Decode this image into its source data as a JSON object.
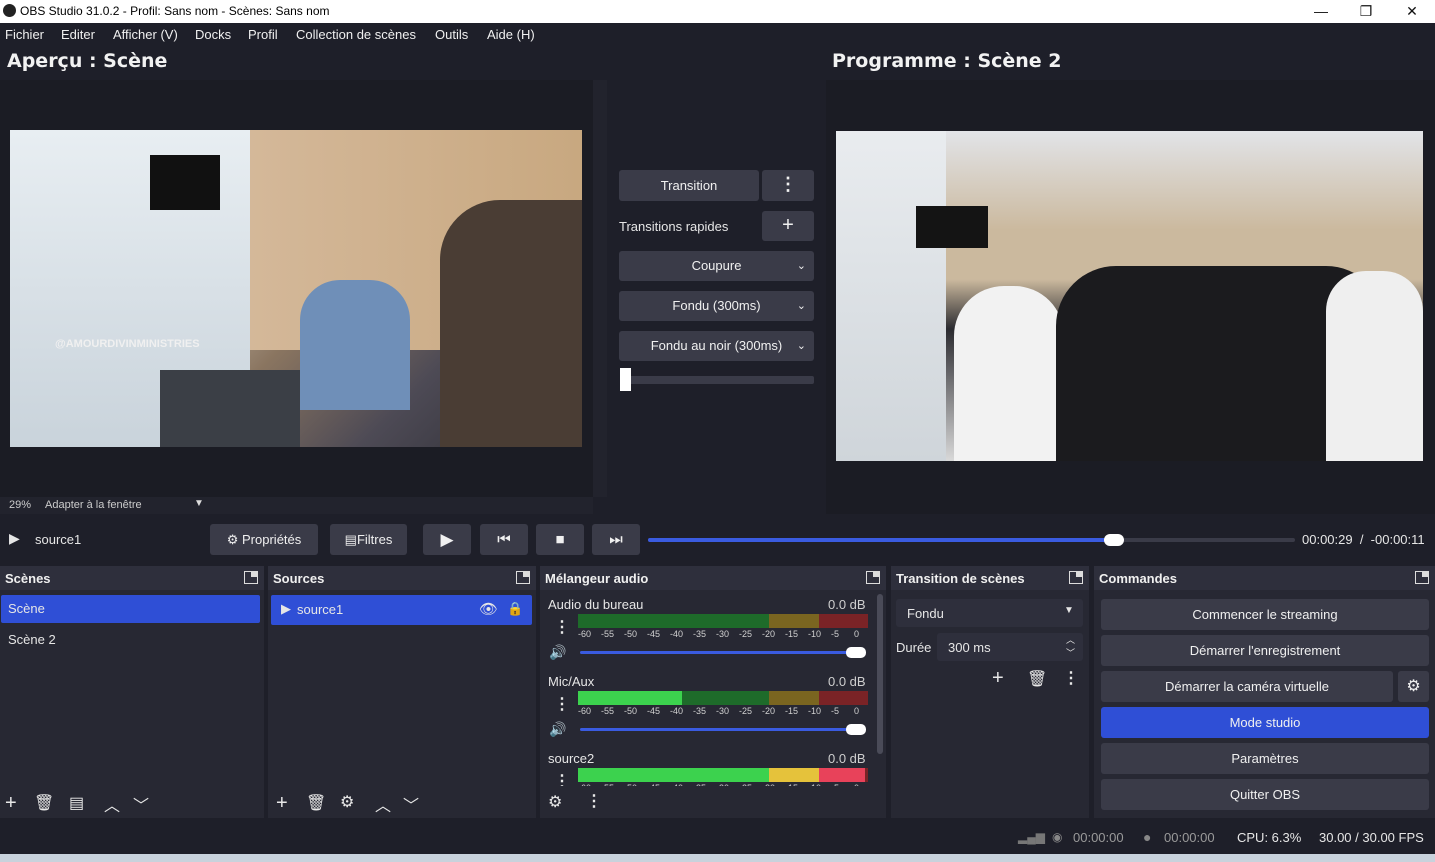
{
  "window": {
    "title": "OBS Studio 31.0.2 - Profil: Sans nom - Scènes: Sans nom",
    "minimize": "—",
    "maximize": "❐",
    "close": "✕"
  },
  "menu": [
    "Fichier",
    "Editer",
    "Afficher (V)",
    "Docks",
    "Profil",
    "Collection de scènes",
    "Outils",
    "Aide (H)"
  ],
  "preview": {
    "title": "Aperçu : Scène",
    "zoom": "29%",
    "fit": "Adapter à la fenêtre",
    "watermark": "@AMOURDIVINMINISTRIES"
  },
  "program": {
    "title": "Programme : Scène 2"
  },
  "transitions": {
    "transition_label": "Transition",
    "quick_label": "Transitions rapides",
    "items": [
      "Coupure",
      "Fondu (300ms)",
      "Fondu au noir (300ms)"
    ]
  },
  "media": {
    "source": "source1",
    "properties": "Propriétés",
    "filters": "Filtres",
    "time": "00:00:29  /  -00:00:11",
    "progress": 0.72
  },
  "scenes": {
    "title": "Scènes",
    "items": [
      "Scène",
      "Scène 2"
    ],
    "selected": 0
  },
  "sources": {
    "title": "Sources",
    "items": [
      "source1"
    ]
  },
  "mixer": {
    "title": "Mélangeur audio",
    "channels": [
      {
        "name": "Audio du bureau",
        "db": "0.0 dB",
        "level": 0.0,
        "volume": 1.0
      },
      {
        "name": "Mic/Aux",
        "db": "0.0 dB",
        "level": 0.36,
        "volume": 1.0
      },
      {
        "name": "source2",
        "db": "0.0 dB",
        "level": 0.99,
        "volume": 1.0
      }
    ],
    "ticks": [
      "-60",
      "-55",
      "-50",
      "-45",
      "-40",
      "-35",
      "-30",
      "-25",
      "-20",
      "-15",
      "-10",
      "-5",
      "0"
    ]
  },
  "scene_transition": {
    "title": "Transition de scènes",
    "type": "Fondu",
    "duration_label": "Durée",
    "duration": "300 ms"
  },
  "controls": {
    "title": "Commandes",
    "buttons": [
      "Commencer le streaming",
      "Démarrer l'enregistrement",
      "Démarrer la caméra virtuelle",
      "Mode studio",
      "Paramètres",
      "Quitter OBS"
    ]
  },
  "status": {
    "stream_time": "00:00:00",
    "rec_time": "00:00:00",
    "cpu": "CPU: 6.3%",
    "fps": "30.00 / 30.00 FPS"
  },
  "colors": {
    "accent": "#2f4fd6",
    "bg": "#1e1f29",
    "dock": "#272833"
  }
}
